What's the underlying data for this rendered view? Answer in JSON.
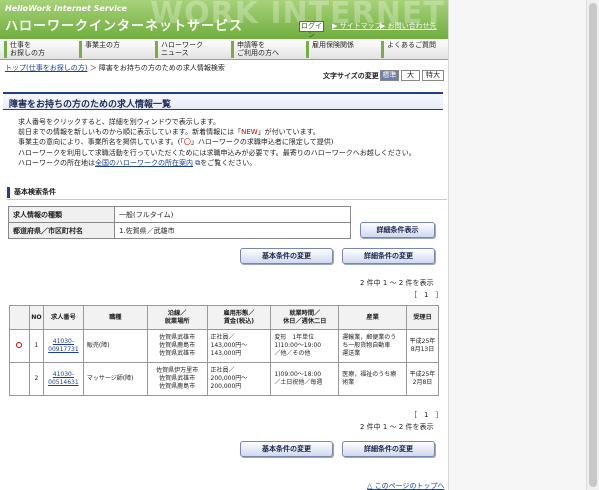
{
  "header": {
    "brand_en": "HelloWork Internet Service",
    "brand_jp": "ハローワークインターネットサービス",
    "watermark": "WORK INTERNET",
    "login": "ログイン",
    "sitemap": "サイトマップ",
    "contact": "お問い合わせ先"
  },
  "nav": [
    {
      "label": "仕事を\nお探しの方"
    },
    {
      "label": "事業主の方"
    },
    {
      "label": "ハローワーク\nニュース"
    },
    {
      "label": "申請等を\nご利用の方へ"
    },
    {
      "label": "雇用保険関係"
    },
    {
      "label": "よくあるご質問"
    }
  ],
  "breadcrumb": {
    "link": "トップ(仕事をお探しの方)",
    "sep": " ＞ ",
    "current": "障害をお持ちの方のための求人情報検索"
  },
  "fontsize": {
    "label": "文字サイズの変更",
    "std": "標準",
    "large": "大",
    "xlarge": "特大"
  },
  "title": "障害をお持ちの方のための求人情報一覧",
  "intro": {
    "l1": "求人番号をクリックすると、詳細を別ウィンドウで表示します。",
    "l2a": "前日までの情報を新しいものから順に表示しています。新着情報には「",
    "l2b": "NEW",
    "l2c": "」が付いています。",
    "l3a": "事業主の意向により、事業所名を掲供しています。(「",
    "l3b": "〇",
    "l3c": "」ハローワークの求職申込者に限定して提供)",
    "l4": "ハローワークを利用して求職活動を行っていただくためには求職申込みが必要です。最寄りのハローワークへお越しください。",
    "l5a": "ハローワークの所在地は",
    "l5b": "全国のハローワークの所在案内",
    "l5c": "をご覧ください。"
  },
  "basic": {
    "title": "基本検索条件",
    "rows": [
      {
        "key": "求人情報の種類",
        "value": "一般(フルタイム)"
      },
      {
        "key": "都道府県／市区町村名",
        "value": "1.佐賀県／武雄市"
      }
    ],
    "detail_show": "詳細条件表示"
  },
  "buttons": {
    "basic_change": "基本条件の変更",
    "detail_change": "詳細条件の変更"
  },
  "paging": {
    "count": "2 件中 1 ～ 2 件を表示",
    "pages": "［　1　］"
  },
  "table": {
    "headers": [
      "",
      "NO",
      "求人番号",
      "職種",
      "沿線／\n就業場所",
      "雇用形態／\n賃金(税込)",
      "就業時間／\n休日／週休二日",
      "産業",
      "受理日"
    ],
    "rows": [
      {
        "mark": "〇",
        "no": "1",
        "job_id": "41030-\n00917731",
        "occupation": "販売(障)",
        "place": "佐賀県武雄市\n佐賀県鹿島市\n佐賀県武雄市",
        "wage": "正社員／\n143,000円～143,000円",
        "hours": "変形　1年単位\n1)10:00～19:00\n／他／その他",
        "industry": "運輸業，郵便業のう\nち一般貨物自動車\n運送業",
        "date": "平成25年\n8月13日"
      },
      {
        "mark": "",
        "no": "2",
        "job_id": "41030-\n00514631",
        "occupation": "マッサージ師(障)",
        "place": "佐賀県伊万里市\n佐賀県武雄市\n佐賀県鹿島市",
        "wage": "正社員／\n200,000円～200,000円",
        "hours": "1)09:00～18:00\n／土日祝他／毎週",
        "industry": "医療，福祉のうち療\n術業",
        "date": "平成25年\n2月8日"
      }
    ]
  },
  "totop": "このページのトップへ"
}
